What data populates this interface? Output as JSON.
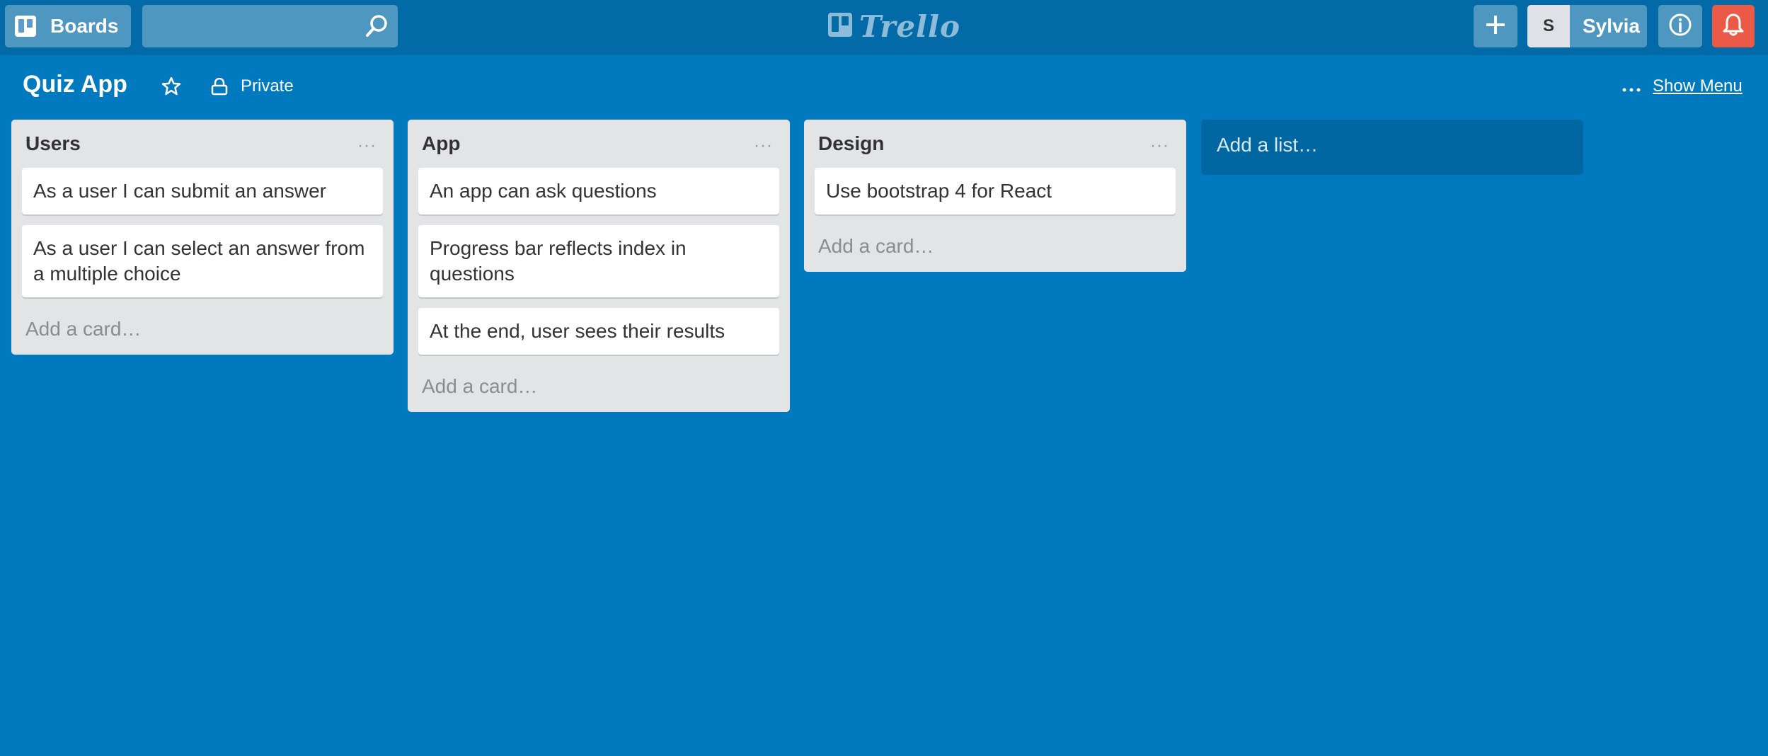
{
  "header": {
    "boards_label": "Boards",
    "search_placeholder": "",
    "logo_text": "Trello",
    "user_initial": "S",
    "user_name": "Sylvia",
    "notification_color": "#eb5a46"
  },
  "board": {
    "title": "Quiz App",
    "privacy": "Private",
    "show_menu": "Show Menu",
    "background_color": "#0079bf"
  },
  "lists": [
    {
      "title": "Users",
      "menu": "···",
      "cards": [
        "As a user I can submit an answer",
        "As a user I can select an answer from a multiple choice"
      ],
      "add_card": "Add a card…"
    },
    {
      "title": "App",
      "menu": "···",
      "cards": [
        "An app can ask questions",
        "Progress bar reflects index in questions",
        "At the end, user sees their results"
      ],
      "add_card": "Add a card…"
    },
    {
      "title": "Design",
      "menu": "···",
      "cards": [
        "Use bootstrap 4 for React"
      ],
      "add_card": "Add a card…"
    }
  ],
  "add_list": "Add a list…"
}
